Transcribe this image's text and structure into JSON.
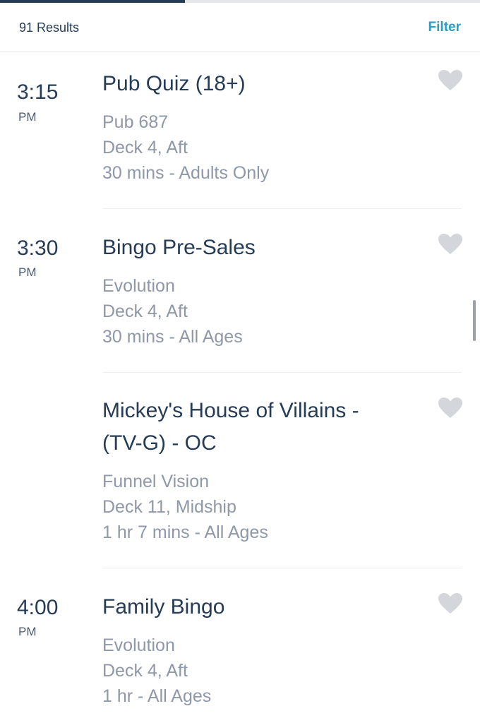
{
  "header": {
    "results_count": "91 Results",
    "filter_label": "Filter",
    "progress": 0.385
  },
  "events": [
    {
      "time": "3:15",
      "ampm": "PM",
      "title": "Pub Quiz (18+)",
      "venue": "Pub 687",
      "location": "Deck 4, Aft",
      "duration": "30 mins - Adults Only",
      "favorited": false
    },
    {
      "time": "3:30",
      "ampm": "PM",
      "title": "Bingo Pre-Sales",
      "venue": "Evolution",
      "location": "Deck 4, Aft",
      "duration": "30 mins - All Ages",
      "favorited": false
    },
    {
      "time": "",
      "ampm": "",
      "title": "Mickey's House of Villains - (TV-G) - OC",
      "venue": "Funnel Vision",
      "location": "Deck 11, Midship",
      "duration": "1 hr 7 mins - All Ages",
      "favorited": false
    },
    {
      "time": "4:00",
      "ampm": "PM",
      "title": "Family Bingo",
      "venue": "Evolution",
      "location": "Deck 4, Aft",
      "duration": "1 hr - All Ages",
      "favorited": false
    }
  ],
  "colors": {
    "primary_text": "#253b56",
    "secondary_text": "#8e98a8",
    "accent": "#2b9ec4",
    "heart": "#d3d6db"
  },
  "icons": {
    "favorite": "heart-icon"
  }
}
